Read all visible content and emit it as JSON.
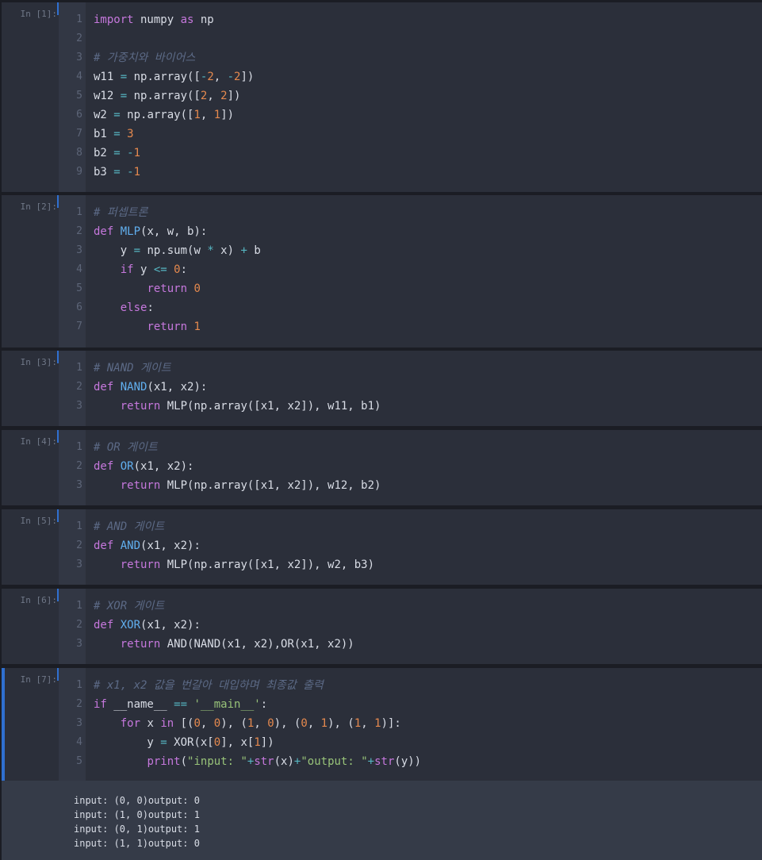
{
  "cells": [
    {
      "prompt": "In [1]:",
      "lines": [
        {
          "n": "1",
          "html": "<span class='kw'>import</span> numpy <span class='kw'>as</span> np"
        },
        {
          "n": "2",
          "html": ""
        },
        {
          "n": "3",
          "html": "<span class='cm'># 가중치와 바이어스</span>"
        },
        {
          "n": "4",
          "html": "w11 <span class='op'>=</span> np.array([<span class='op'>-</span><span class='nm'>2</span>, <span class='op'>-</span><span class='nm'>2</span>])"
        },
        {
          "n": "5",
          "html": "w12 <span class='op'>=</span> np.array([<span class='nm'>2</span>, <span class='nm'>2</span>])"
        },
        {
          "n": "6",
          "html": "w2 <span class='op'>=</span> np.array([<span class='nm'>1</span>, <span class='nm'>1</span>])"
        },
        {
          "n": "7",
          "html": "b1 <span class='op'>=</span> <span class='nm'>3</span>"
        },
        {
          "n": "8",
          "html": "b2 <span class='op'>=</span> <span class='op'>-</span><span class='nm'>1</span>"
        },
        {
          "n": "9",
          "html": "b3 <span class='op'>=</span> <span class='op'>-</span><span class='nm'>1</span>"
        }
      ]
    },
    {
      "prompt": "In [2]:",
      "lines": [
        {
          "n": "1",
          "html": "<span class='cm'># 퍼셉트론</span>"
        },
        {
          "n": "2",
          "html": "<span class='kw'>def</span> <span class='fn'>MLP</span>(x, w, b):"
        },
        {
          "n": "3",
          "html": "    y <span class='op'>=</span> np.sum(w <span class='op'>*</span> x) <span class='op'>+</span> b"
        },
        {
          "n": "4",
          "html": "    <span class='kw'>if</span> y <span class='op'>&lt;=</span> <span class='nm'>0</span>:"
        },
        {
          "n": "5",
          "html": "        <span class='kw'>return</span> <span class='nm'>0</span>"
        },
        {
          "n": "6",
          "html": "    <span class='kw'>else</span>:"
        },
        {
          "n": "7",
          "html": "        <span class='kw'>return</span> <span class='nm'>1</span>"
        }
      ]
    },
    {
      "prompt": "In [3]:",
      "lines": [
        {
          "n": "1",
          "html": "<span class='cm'># NAND 게이트</span>"
        },
        {
          "n": "2",
          "html": "<span class='kw'>def</span> <span class='fn'>NAND</span>(x1, x2):"
        },
        {
          "n": "3",
          "html": "    <span class='kw'>return</span> MLP(np.array([x1, x2]), w11, b1)"
        }
      ]
    },
    {
      "prompt": "In [4]:",
      "lines": [
        {
          "n": "1",
          "html": "<span class='cm'># OR 게이트</span>"
        },
        {
          "n": "2",
          "html": "<span class='kw'>def</span> <span class='fn'>OR</span>(x1, x2):"
        },
        {
          "n": "3",
          "html": "    <span class='kw'>return</span> MLP(np.array([x1, x2]), w12, b2)"
        }
      ]
    },
    {
      "prompt": "In [5]:",
      "lines": [
        {
          "n": "1",
          "html": "<span class='cm'># AND 게이트</span>"
        },
        {
          "n": "2",
          "html": "<span class='kw'>def</span> <span class='fn'>AND</span>(x1, x2):"
        },
        {
          "n": "3",
          "html": "    <span class='kw'>return</span> MLP(np.array([x1, x2]), w2, b3)"
        }
      ]
    },
    {
      "prompt": "In [6]:",
      "lines": [
        {
          "n": "1",
          "html": "<span class='cm'># XOR 게이트</span>"
        },
        {
          "n": "2",
          "html": "<span class='kw'>def</span> <span class='fn'>XOR</span>(x1, x2):"
        },
        {
          "n": "3",
          "html": "    <span class='kw'>return</span> AND(NAND(x1, x2),OR(x1, x2))"
        }
      ]
    },
    {
      "prompt": "In [7]:",
      "lines": [
        {
          "n": "1",
          "html": "<span class='cm'># x1, x2 값을 번갈아 대입하며 최종값 출력</span>"
        },
        {
          "n": "2",
          "html": "<span class='kw'>if</span> __name__ <span class='op'>==</span> <span class='st'>'__main__'</span>:"
        },
        {
          "n": "3",
          "html": "    <span class='kw'>for</span> x <span class='kw'>in</span> [(<span class='nm'>0</span>, <span class='nm'>0</span>), (<span class='nm'>1</span>, <span class='nm'>0</span>), (<span class='nm'>0</span>, <span class='nm'>1</span>), (<span class='nm'>1</span>, <span class='nm'>1</span>)]:"
        },
        {
          "n": "4",
          "html": "        y <span class='op'>=</span> XOR(x[<span class='nm'>0</span>], x[<span class='nm'>1</span>])"
        },
        {
          "n": "5",
          "html": "        <span class='bi'>print</span>(<span class='st'>\"input: \"</span><span class='op'>+</span><span class='bi'>str</span>(x)<span class='op'>+</span><span class='st'>\"output: \"</span><span class='op'>+</span><span class='bi'>str</span>(y))"
        }
      ]
    }
  ],
  "output": [
    "input: (0, 0)output: 0",
    "input: (1, 0)output: 1",
    "input: (0, 1)output: 1",
    "input: (1, 1)output: 0"
  ]
}
